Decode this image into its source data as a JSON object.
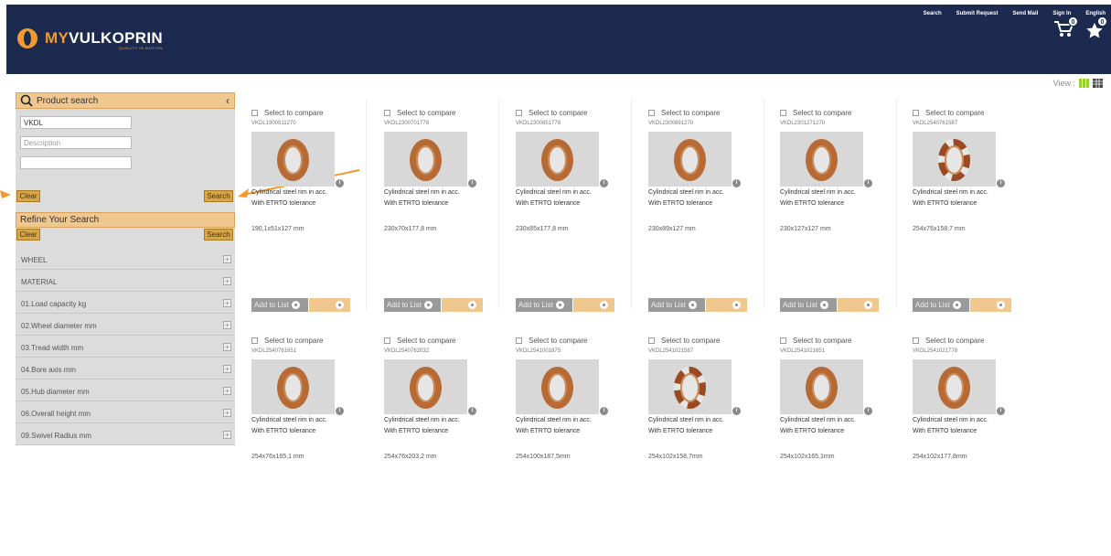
{
  "header": {
    "logo": {
      "my": "MY",
      "brand": "VULKOPRIN",
      "tagline": "QUALITY IN MOTION"
    },
    "nav": [
      "Search",
      "Submit Request",
      "Send Mail",
      "Sign In",
      "English"
    ],
    "cart_count": "0",
    "wishlist_count": "0"
  },
  "view_label": "View :",
  "sidebar": {
    "title": "Product search",
    "code_value": "VKDL",
    "description_placeholder": "Description",
    "third_value": "",
    "clear_label": "Clear",
    "search_label": "Search",
    "refine_title": "Refine Your Search",
    "filters": [
      "WHEEL",
      "MATERIAL",
      "01.Load capacity kg",
      "02.Wheel diameter mm",
      "03.Tread width mm",
      "04.Bore axis mm",
      "05.Hub diameter mm",
      "06.Overall height mm",
      "09.Swivel Radius mm"
    ]
  },
  "products": {
    "compare_label": "Select to compare",
    "desc_line1": "Cylindrical steel rim in acc.",
    "desc_line2": "With ETRTO tolerance",
    "add_label": "Add to List",
    "info_icon": "i",
    "items": [
      {
        "code": "VKDL1900511270",
        "dims": "190,1x51x127 mm",
        "toothed": false
      },
      {
        "code": "VKDL2300701778",
        "dims": "230x70x177,8 mm",
        "toothed": false
      },
      {
        "code": "VKDL2300851778",
        "dims": "230x85x177,8 mm",
        "toothed": false
      },
      {
        "code": "VKDL2300891270",
        "dims": "230x89x127 mm",
        "toothed": false
      },
      {
        "code": "VKDL2301271270",
        "dims": "230x127x127 mm",
        "toothed": false
      },
      {
        "code": "VKDL2540761587",
        "dims": "254x76x158,7 mm",
        "toothed": true
      },
      {
        "code": "VKDL2540761651",
        "dims": "254x76x165,1 mm",
        "toothed": false
      },
      {
        "code": "VKDL2540762032",
        "dims": "254x76x203,2 mm",
        "toothed": false
      },
      {
        "code": "VKDL2541001875",
        "dims": "254x100x187,5mm",
        "toothed": false
      },
      {
        "code": "VKDL2541021587",
        "dims": "254x102x158,7mm",
        "toothed": true
      },
      {
        "code": "VKDL2541021651",
        "dims": "254x102x165,1mm",
        "toothed": false
      },
      {
        "code": "VKDL2541021778",
        "dims": "254x102x177,8mm",
        "toothed": false
      }
    ]
  },
  "colors": {
    "header": "#1b2a4e",
    "accent": "#f29a2e",
    "panel": "#f0c78e",
    "button": "#d8a64a"
  }
}
